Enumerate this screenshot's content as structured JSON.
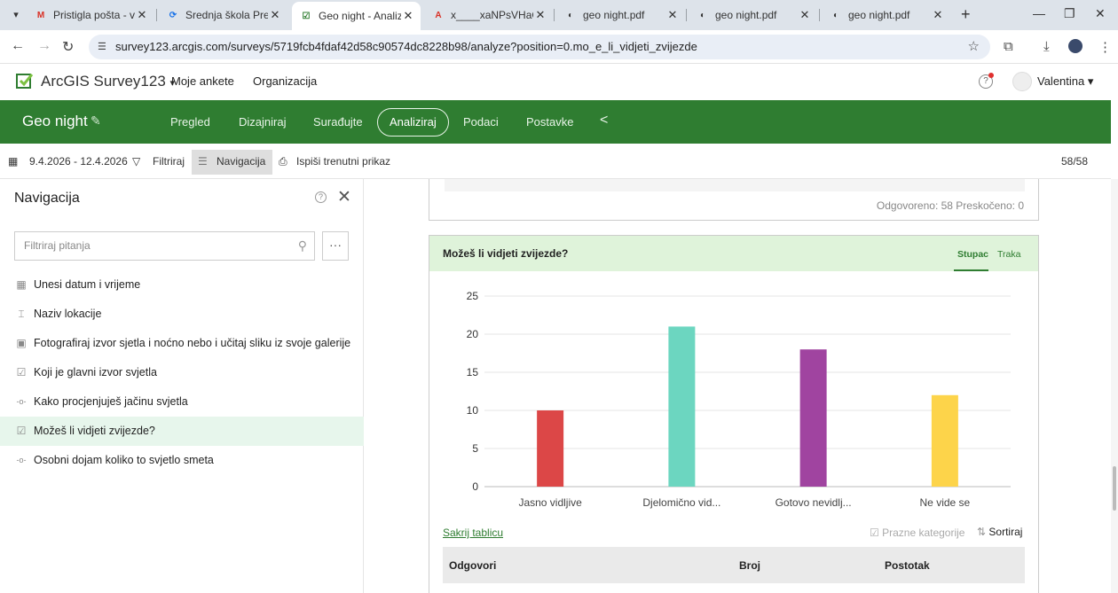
{
  "browser": {
    "tabs": [
      {
        "label": "Pristigla pošta - valen",
        "favicon": "M",
        "color": "#d93025"
      },
      {
        "label": "Srednja škola Prelog",
        "favicon": "⟳",
        "color": "#1a73e8"
      },
      {
        "label": "Geo night - Analiziraj",
        "favicon": "☑",
        "color": "#2f7d31"
      },
      {
        "label": "x____xaNPsVHaOna",
        "favicon": "A",
        "color": "#d93025"
      },
      {
        "label": "geo night.pdf",
        "favicon": "◐",
        "color": "#333333"
      },
      {
        "label": "geo night.pdf",
        "favicon": "◐",
        "color": "#333333"
      },
      {
        "label": "geo night.pdf",
        "favicon": "◐",
        "color": "#333333"
      }
    ],
    "url": "survey123.arcgis.com/surveys/5719fcb4fdaf42d58c90574dc8228b98/analyze?position=0.mo_e_li_vidjeti_zvijezde"
  },
  "app": {
    "name": "ArcGIS Survey123",
    "dropdown_caret": "▾",
    "links": [
      "Moje ankete",
      "Organizacija"
    ],
    "user": "Valentina ▾"
  },
  "survey": {
    "name": "Geo night",
    "tabs": [
      "Pregled",
      "Dizajniraj",
      "Surađujte",
      "Analiziraj",
      "Podaci",
      "Postavke"
    ],
    "active_tab": "Analiziraj"
  },
  "toolbar": {
    "date_range": "9.4.2026 - 12.4.2026",
    "filter": "Filtriraj",
    "navigation": "Navigacija",
    "print": "Ispiši trenutni prikaz",
    "count": "58/58"
  },
  "navigation_panel": {
    "title": "Navigacija",
    "search_placeholder": "Filtriraj pitanja",
    "questions": [
      {
        "label": "Unesi datum i vrijeme",
        "icon": "calendar-icon"
      },
      {
        "label": "Naziv lokacije",
        "icon": "text-field-icon"
      },
      {
        "label": "Fotografiraj izvor sjetla i noćno nebo i učitaj sliku iz svoje galerije",
        "icon": "image-icon"
      },
      {
        "label": "Koji je glavni izvor svjetla",
        "icon": "checkbox-icon"
      },
      {
        "label": "Kako procjenjuješ jačinu svjetla",
        "icon": "slider-icon"
      },
      {
        "label": "Možeš li vidjeti zvijezde?",
        "icon": "checkbox-icon",
        "active": true
      },
      {
        "label": "Osobni dojam koliko to svjetlo smeta",
        "icon": "slider-icon"
      }
    ]
  },
  "previous_card": {
    "stats": "Odgovoreno: 58  Preskočeno: 0"
  },
  "question_card": {
    "title": "Možeš li vidjeti zvijezde?",
    "view_tabs": [
      "Stupac",
      "Traka"
    ],
    "active_view": "Stupac",
    "hide_table": "Sakrij tablicu",
    "empty_categories": "Prazne kategorije",
    "sort": "Sortiraj",
    "table_headers": [
      "Odgovori",
      "Broj",
      "Postotak"
    ]
  },
  "chart_data": {
    "type": "bar",
    "categories": [
      "Jasno vidljive",
      "Djelomično vid...",
      "Gotovo nevidlj...",
      "Ne vide se"
    ],
    "values": [
      10,
      21,
      18,
      12
    ],
    "colors": [
      "#dc4747",
      "#6cd6c0",
      "#a044a0",
      "#fdd44a"
    ],
    "ylim": [
      0,
      25
    ],
    "yticks": [
      0,
      5,
      10,
      15,
      20,
      25
    ],
    "grid": true
  }
}
